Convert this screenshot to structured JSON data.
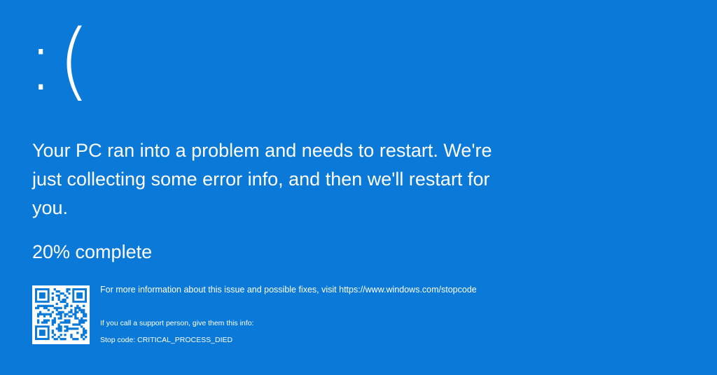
{
  "bsod": {
    "face": ":(",
    "message": "Your PC ran into a problem and needs to restart. We're just collecting some error info, and then we'll restart for you.",
    "progress_percent": 20,
    "progress_text": "20% complete",
    "more_info": "For more information about this issue and possible fixes, visit https://www.windows.com/stopcode",
    "support_text": "If you call a support person, give them this info:",
    "stop_code_label": "Stop code:",
    "stop_code": "CRITICAL_PROCESS_DIED",
    "qr_icon": "qr-code-icon"
  },
  "colors": {
    "background": "#0a79d8",
    "text": "#ffffff"
  }
}
